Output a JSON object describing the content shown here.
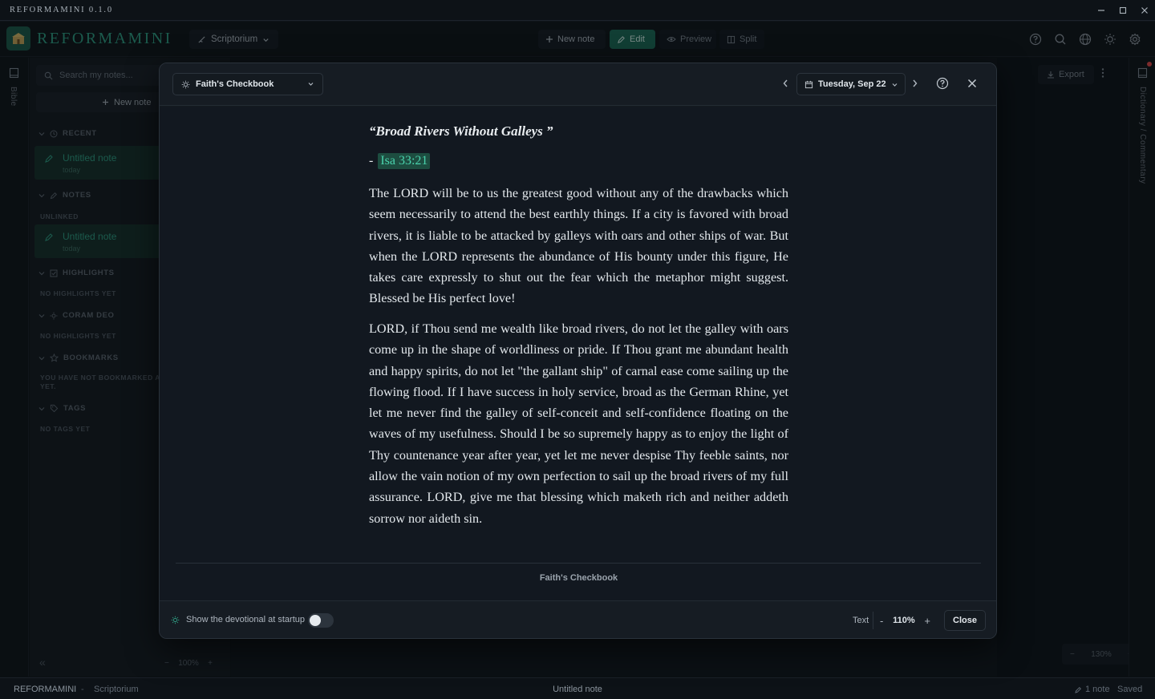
{
  "window": {
    "title": "REFORMAMINI 0.1.0"
  },
  "header": {
    "brand": "REFORMAMINI",
    "workspace": "Scriptorium",
    "new_note": "New note",
    "edit": "Edit",
    "preview": "Preview",
    "split": "Split"
  },
  "left_rail": {
    "label": "Bible"
  },
  "sidebar": {
    "search_placeholder": "Search my notes...",
    "new_note": "New note",
    "recent": {
      "heading": "RECENT",
      "item_title": "Untitled note",
      "item_date": "today"
    },
    "notes": {
      "heading": "NOTES",
      "sub": "UNLINKED",
      "item_title": "Untitled note",
      "item_date": "today"
    },
    "highlights": {
      "heading": "HIGHLIGHTS",
      "empty": "NO HIGHLIGHTS YET"
    },
    "coram_deo": {
      "heading": "CORAM DEO",
      "empty": "NO HIGHLIGHTS YET"
    },
    "bookmarks": {
      "heading": "BOOKMARKS",
      "empty": "YOU HAVE NOT BOOKMARKED A\nYET."
    },
    "tags": {
      "heading": "TAGS",
      "empty": "NO TAGS YET"
    },
    "collapse": "«"
  },
  "editor": {
    "zoom": "100%",
    "minus": "−",
    "plus": "+"
  },
  "right_panel": {
    "export": "Export",
    "zoom": "130%",
    "minus": "−",
    "plus": "+"
  },
  "right_rail": {
    "label": "Dictionary / Commentary"
  },
  "devotional": {
    "source": "Faith's Checkbook",
    "date": "Tuesday, Sep 22",
    "title": "“Broad Rivers Without Galleys ”",
    "ref_prefix": "-",
    "reference": "Isa 33:21",
    "paragraphs": [
      "The LORD will be to us the greatest good without any of the drawbacks which seem necessarily to attend the best earthly things. If a city is favored with broad rivers, it is liable to be attacked by galleys with oars and other ships of war. But when the LORD represents the abundance of His bounty under this figure, He takes care expressly to shut out the fear which the metaphor might suggest. Blessed be His perfect love!",
      "LORD, if Thou send me wealth like broad rivers, do not let the galley with oars come up in the shape of worldliness or pride. If Thou grant me abundant health and happy spirits, do not let \"the gallant ship\" of carnal ease come sailing up the flowing flood. If I have success in holy service, broad as the German Rhine, yet let me never find the galley of self-conceit and self-confidence floating on the waves of my usefulness. Should I be so supremely happy as to enjoy the light of Thy countenance year after year, yet let me never despise Thy feeble saints, nor allow the vain notion of my own perfection to sail up the broad rivers of my full assurance. LORD, give me that blessing which maketh rich and neither addeth sorrow nor aideth sin."
    ],
    "footer_source": "Faith's Checkbook",
    "startup_label": "Show the devotional at startup",
    "startup_enabled": false,
    "text_label": "Text",
    "text_zoom": "110%",
    "zoom_minus": "-",
    "zoom_plus": "+",
    "close": "Close"
  },
  "status": {
    "app": "REFORMAMINI",
    "sep": "-",
    "workspace": "Scriptorium",
    "note": "Untitled note",
    "count": "1 note",
    "saved": "Saved"
  },
  "colors": {
    "accent": "#2f9d82",
    "accent_dark": "#1d6b57",
    "link_bg": "#1d4d40",
    "link_fg": "#4ad3ad"
  }
}
